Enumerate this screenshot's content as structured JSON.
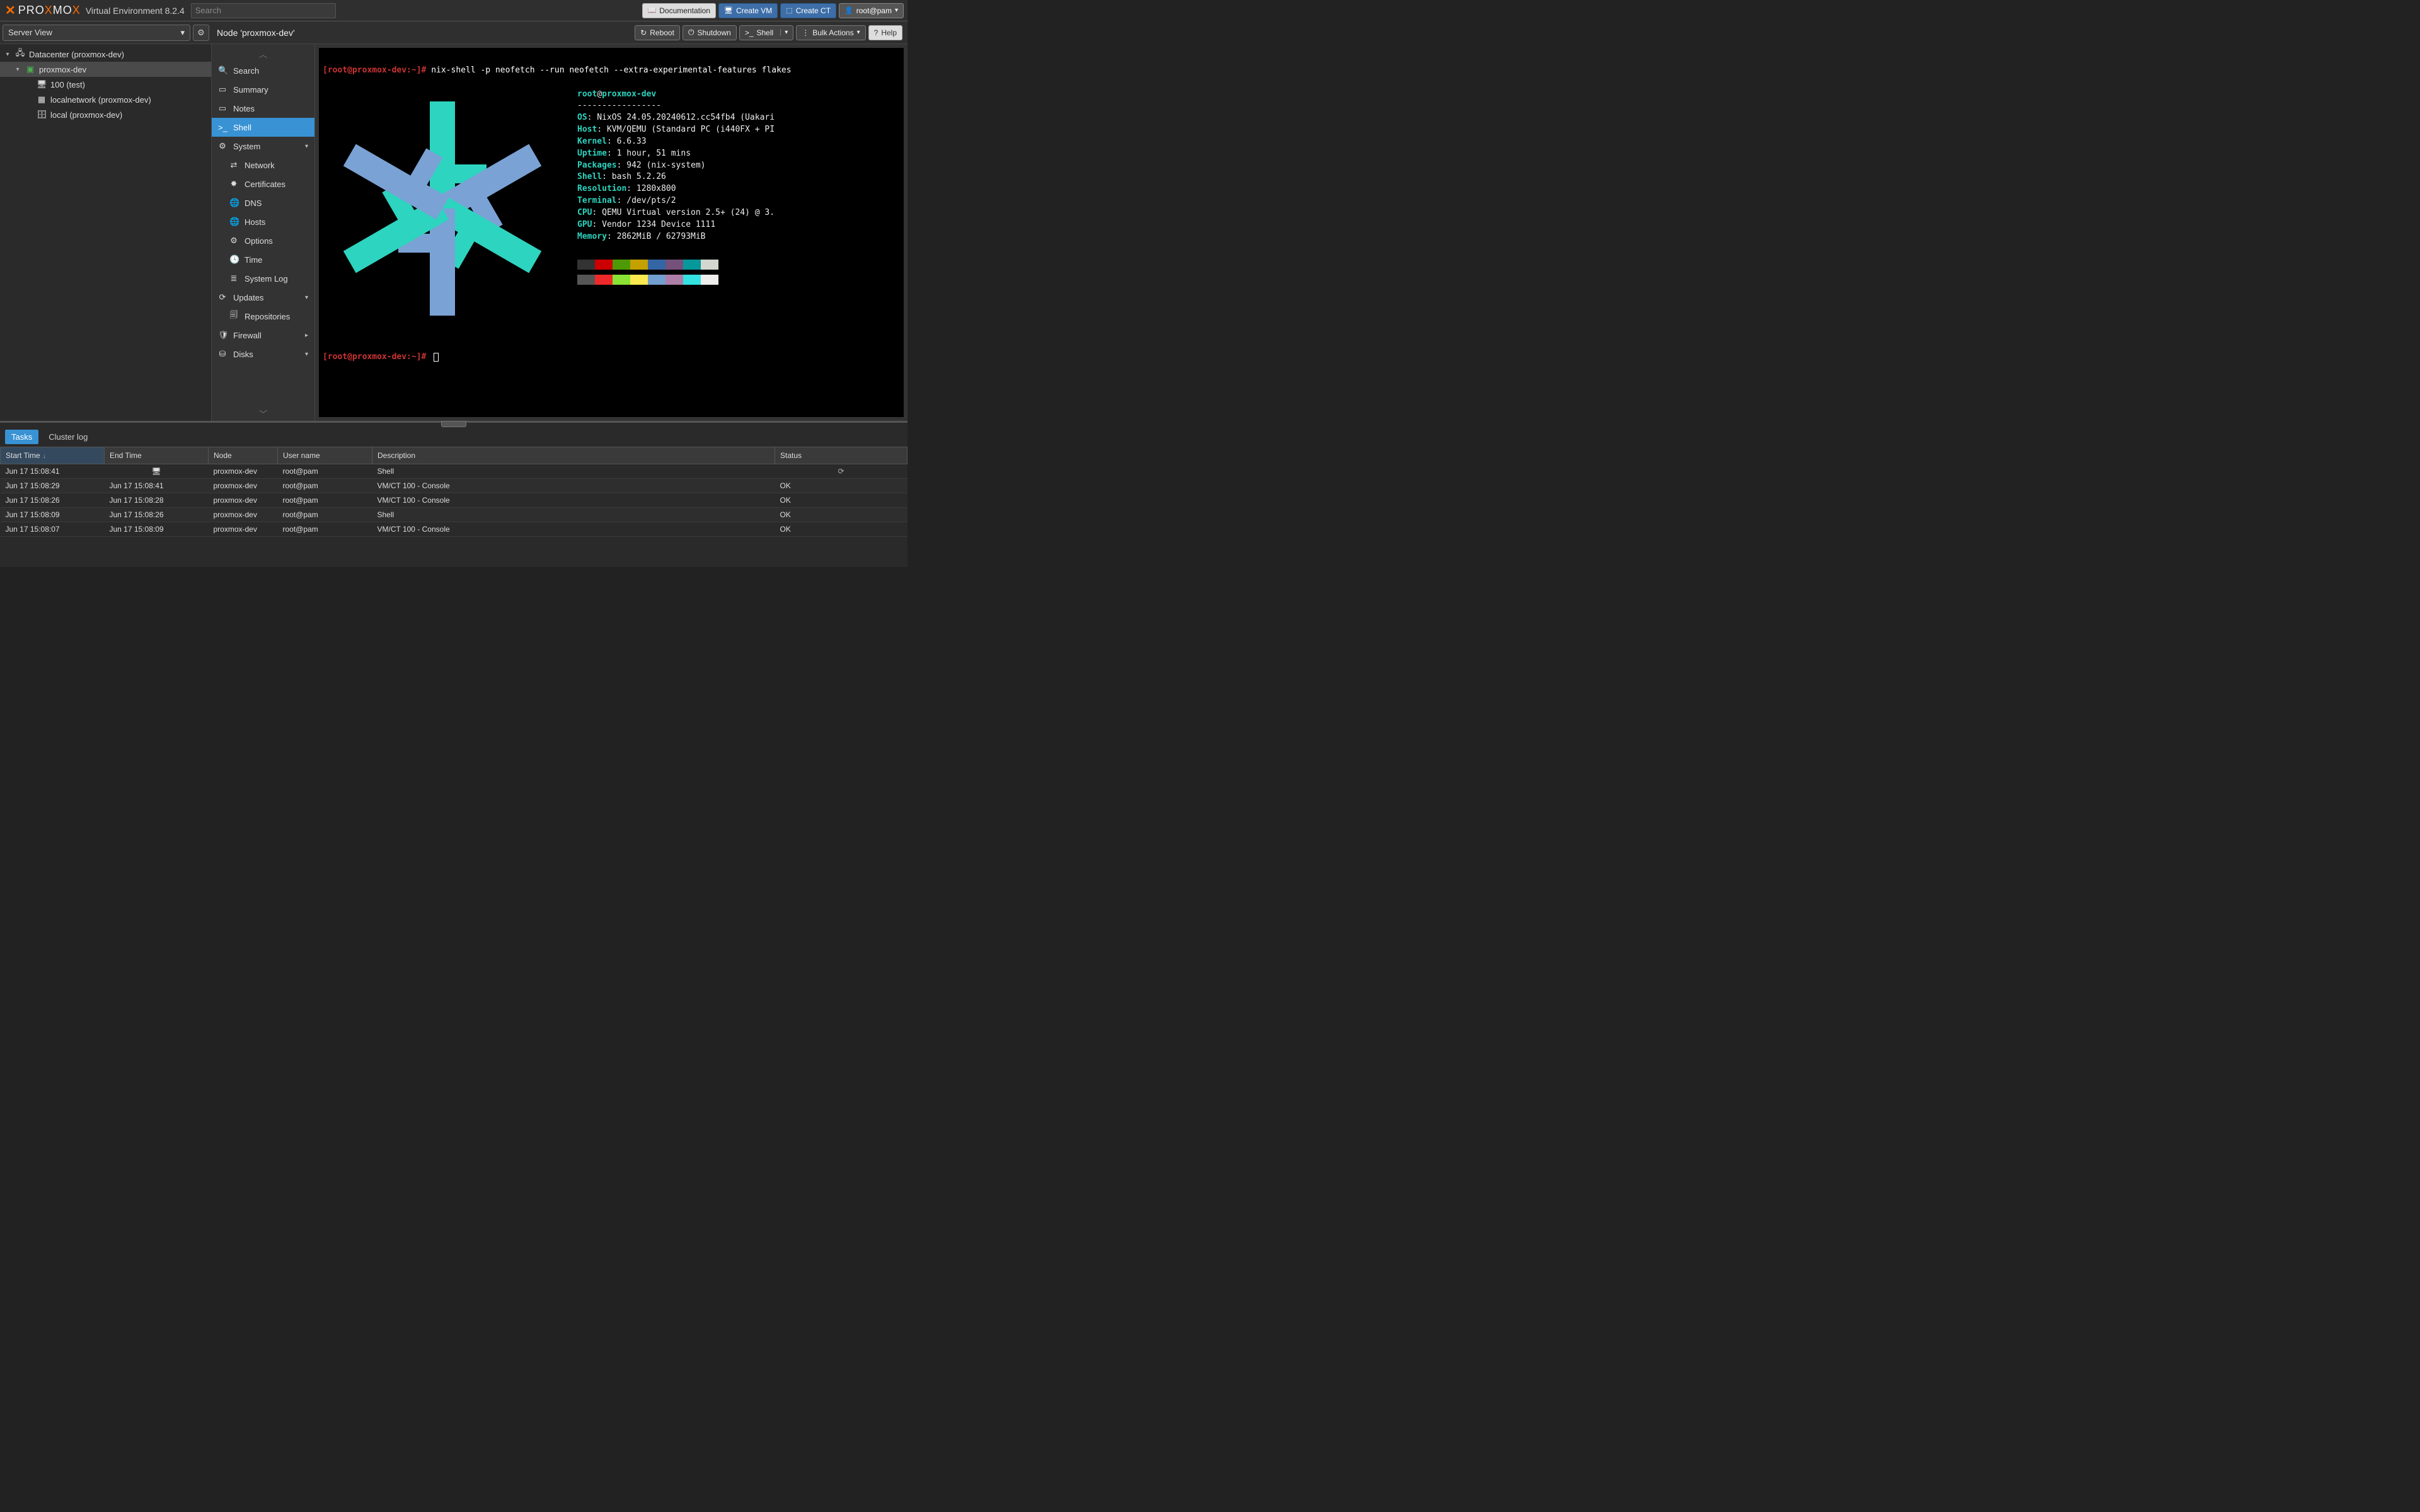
{
  "top": {
    "logo_white": "PRO",
    "logo_orange1": "X",
    "logo_white2": "MO",
    "logo_orange2": "X",
    "product": "Virtual Environment 8.2.4",
    "search_placeholder": "Search"
  },
  "topButtons": {
    "docs": "Documentation",
    "createVm": "Create VM",
    "createCt": "Create CT",
    "user": "root@pam"
  },
  "serverView": {
    "label": "Server View"
  },
  "tree": {
    "datacenter": "Datacenter (proxmox-dev)",
    "node": "proxmox-dev",
    "vm": "100 (test)",
    "net": "localnetwork (proxmox-dev)",
    "storage": "local (proxmox-dev)"
  },
  "contentHeader": {
    "title": "Node 'proxmox-dev'"
  },
  "contentActions": {
    "reboot": "Reboot",
    "shutdown": "Shutdown",
    "shell": "Shell",
    "bulk": "Bulk Actions",
    "help": "Help"
  },
  "sidenav": {
    "search": "Search",
    "summary": "Summary",
    "notes": "Notes",
    "shell": "Shell",
    "system": "System",
    "network": "Network",
    "certificates": "Certificates",
    "dns": "DNS",
    "hosts": "Hosts",
    "options": "Options",
    "time": "Time",
    "syslog": "System Log",
    "updates": "Updates",
    "repositories": "Repositories",
    "firewall": "Firewall",
    "disks": "Disks"
  },
  "term": {
    "prompt": "[root@proxmox-dev:~]#",
    "cmd": "nix-shell -p neofetch --run neofetch --extra-experimental-features flakes",
    "title_user": "root",
    "title_sep": "@",
    "title_host": "proxmox-dev",
    "dash": "-----------------",
    "info": [
      [
        "OS",
        "NixOS 24.05.20240612.cc54fb4 (Uakari"
      ],
      [
        "Host",
        "KVM/QEMU (Standard PC (i440FX + PI"
      ],
      [
        "Kernel",
        "6.6.33"
      ],
      [
        "Uptime",
        "1 hour, 51 mins"
      ],
      [
        "Packages",
        "942 (nix-system)"
      ],
      [
        "Shell",
        "bash 5.2.26"
      ],
      [
        "Resolution",
        "1280x800"
      ],
      [
        "Terminal",
        "/dev/pts/2"
      ],
      [
        "CPU",
        "QEMU Virtual version 2.5+ (24) @ 3."
      ],
      [
        "GPU",
        "Vendor 1234 Device 1111"
      ],
      [
        "Memory",
        "2862MiB / 62793MiB"
      ]
    ],
    "swatches1": [
      "#333333",
      "#cc0000",
      "#4e9a06",
      "#c4a000",
      "#3465a4",
      "#75507b",
      "#06989a",
      "#d3d7cf"
    ],
    "swatches2": [
      "#555555",
      "#ef2929",
      "#8ae234",
      "#fce94f",
      "#729fcf",
      "#ad7fa8",
      "#34e2e2",
      "#eeeeec"
    ]
  },
  "bottomTabs": {
    "tasks": "Tasks",
    "cluster": "Cluster log"
  },
  "taskCols": [
    "Start Time",
    "End Time",
    "Node",
    "User name",
    "Description",
    "Status"
  ],
  "tasks": [
    {
      "start": "Jun 17 15:08:41",
      "end": "",
      "endIcon": true,
      "node": "proxmox-dev",
      "user": "root@pam",
      "desc": "Shell",
      "status": "",
      "spinner": true
    },
    {
      "start": "Jun 17 15:08:29",
      "end": "Jun 17 15:08:41",
      "node": "proxmox-dev",
      "user": "root@pam",
      "desc": "VM/CT 100 - Console",
      "status": "OK"
    },
    {
      "start": "Jun 17 15:08:26",
      "end": "Jun 17 15:08:28",
      "node": "proxmox-dev",
      "user": "root@pam",
      "desc": "VM/CT 100 - Console",
      "status": "OK"
    },
    {
      "start": "Jun 17 15:08:09",
      "end": "Jun 17 15:08:26",
      "node": "proxmox-dev",
      "user": "root@pam",
      "desc": "Shell",
      "status": "OK"
    },
    {
      "start": "Jun 17 15:08:07",
      "end": "Jun 17 15:08:09",
      "node": "proxmox-dev",
      "user": "root@pam",
      "desc": "VM/CT 100 - Console",
      "status": "OK"
    }
  ]
}
